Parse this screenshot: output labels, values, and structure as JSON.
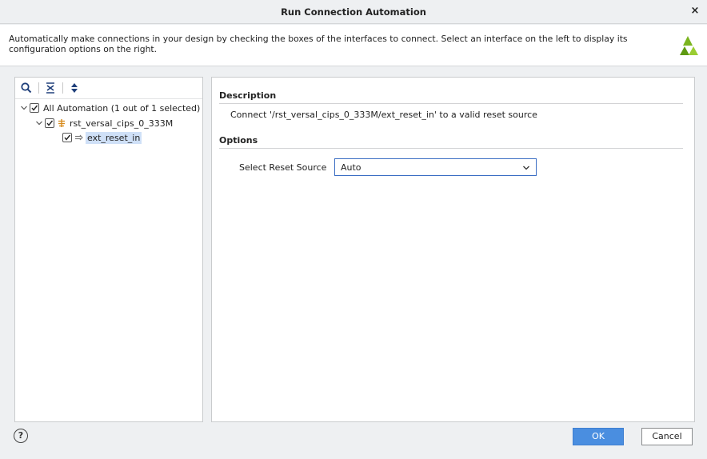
{
  "window": {
    "title": "Run Connection Automation",
    "close_glyph": "×"
  },
  "banner": {
    "description": "Automatically make connections in your design by checking the boxes of the interfaces to connect. Select an interface on the left to display its configuration options on the right.",
    "logo_icon": "vivado-logo-icon"
  },
  "tree_toolbar": {
    "icons": [
      "search-icon",
      "collapse-all-icon",
      "expand-all-icon"
    ]
  },
  "tree": {
    "root": {
      "label": "All Automation (1 out of 1 selected)",
      "checked": true,
      "expanded": true
    },
    "child": {
      "label": "rst_versal_cips_0_333M",
      "checked": true,
      "expanded": true
    },
    "leaf": {
      "label": "ext_reset_in",
      "checked": true,
      "selected": true
    }
  },
  "details": {
    "description_heading": "Description",
    "description_text": "Connect '/rst_versal_cips_0_333M/ext_reset_in' to a valid reset source",
    "options_heading": "Options",
    "reset_source_label": "Select Reset Source",
    "reset_source_value": "Auto"
  },
  "footer": {
    "help_glyph": "?",
    "ok_label": "OK",
    "cancel_label": "Cancel"
  },
  "colors": {
    "accent": "#4a8ee0",
    "selection": "#cfe0f7",
    "logo_green": "#7bb51f"
  }
}
